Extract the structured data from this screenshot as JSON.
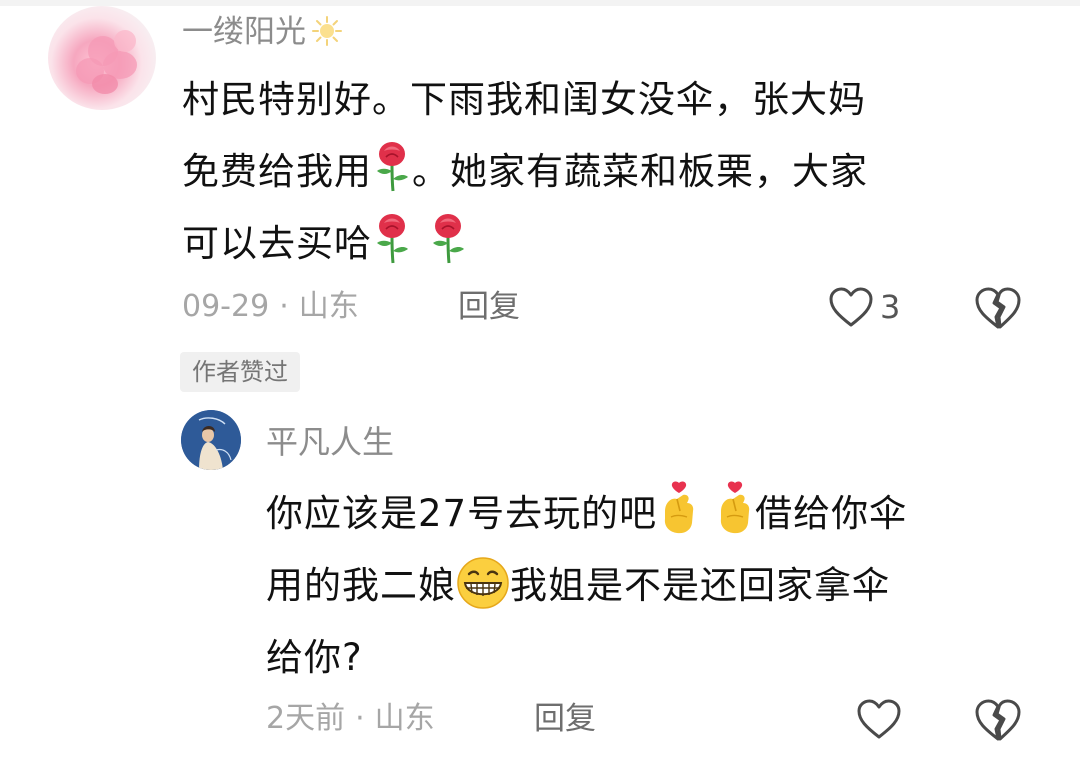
{
  "comment": {
    "username": "一缕阳光",
    "username_icon": "sun-icon",
    "text_lines": [
      "村民特别好。下雨我和闺女没伞，张大妈",
      "免费给我用",
      "。她家有蔬菜和板栗，大家",
      "可以去买哈"
    ],
    "emoji": "rose-emoji",
    "date": "09-29",
    "dot": "·",
    "location": "山东",
    "reply_label": "回复",
    "like_count": "3",
    "author_liked_badge": "作者赞过"
  },
  "reply": {
    "username": "平凡人生",
    "text_lines": [
      "你应该是27号去玩的吧",
      "借给你伞",
      "用的我二娘",
      "我姐是不是还回家拿伞",
      "给你?"
    ],
    "emojis": [
      "finger-heart-emoji",
      "grinning-face-emoji"
    ],
    "date": "2天前",
    "dot": "·",
    "location": "山东",
    "reply_label": "回复"
  },
  "colors": {
    "username": "#8c8c8c",
    "text": "#111111",
    "meta": "#a6a6a6",
    "rose": "#e0304a",
    "finger_heart": "#f7c531",
    "badge_bg": "#f0f0f0"
  }
}
